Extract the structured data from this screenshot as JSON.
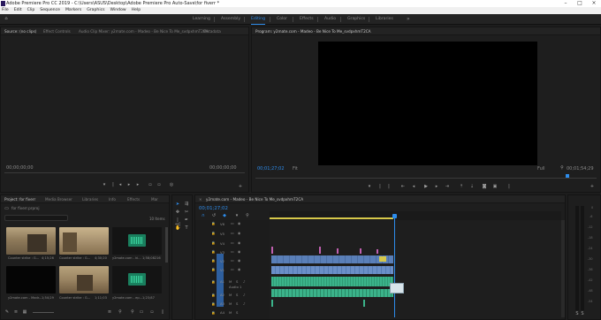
{
  "window": {
    "title": "Adobe Premiere Pro CC 2019 - C:\\Users\\ASUS\\Desktop\\Adobe Premiere Pro Auto-Save\\for fiverr *",
    "min": "–",
    "max": "□",
    "close": "×"
  },
  "menu": [
    "File",
    "Edit",
    "Clip",
    "Sequence",
    "Markers",
    "Graphics",
    "Window",
    "Help"
  ],
  "workspaces": {
    "items": [
      "Learning",
      "Assembly",
      "Editing",
      "Color",
      "Effects",
      "Audio",
      "Graphics",
      "Libraries"
    ],
    "active": "Editing",
    "more": "»"
  },
  "source": {
    "tabs": [
      "Source: (no clips)",
      "Effect Controls",
      "Audio Clip Mixer: y2mate.com - Madeo - Be Nice To Me_svdpxhmT2CA",
      "Metadata"
    ],
    "tc_left": "00;00;00;00",
    "tc_right": "00;00;00;00"
  },
  "program": {
    "tab": "Program: y2mate.com - Madeo - Be Nice To Me_svdpxhmT2CA",
    "tc_left": "00;01;27;02",
    "fit": "Fit",
    "quality": "Full",
    "tc_right": "00;01;54;29"
  },
  "project": {
    "tabs": [
      "Project: for fiverr",
      "Media Browser",
      "Libraries",
      "Info",
      "Effects",
      "Mar"
    ],
    "bin": "for fiverr.prproj",
    "items_count": "10 Items",
    "thumbs": [
      {
        "caption": "Counter strike : G...",
        "duration": "4;15;26"
      },
      {
        "caption": "Counter strike : G...",
        "duration": "4;30;20"
      },
      {
        "caption": "y2mate.com - ki...",
        "duration": "1;58;08216"
      },
      {
        "caption": "y2mate.com - Madr...",
        "duration": "1;54;29"
      },
      {
        "caption": "Counter strike : G...",
        "duration": "1;11;03"
      },
      {
        "caption": "y2mate.com - ep...",
        "duration": "1;23;87"
      }
    ]
  },
  "timeline": {
    "tab": "y2mate.com - Madeo - Be Nice To Me_svdpxhmT2CA",
    "timecode": "00;01;27;02",
    "video_tracks": [
      "V6",
      "V5",
      "V4",
      "V3",
      "V2",
      "V1"
    ],
    "audio_tracks": [
      "A1",
      "A2",
      "A3",
      "A4"
    ],
    "audio1_label": "Audio 1"
  },
  "colors": {
    "accent": "#2d8ceb",
    "video_clip": "#5a7fb8",
    "audio_clip": "#3bb38a",
    "pink_clip": "#c060b0",
    "playhead": "#2d8ceb"
  }
}
